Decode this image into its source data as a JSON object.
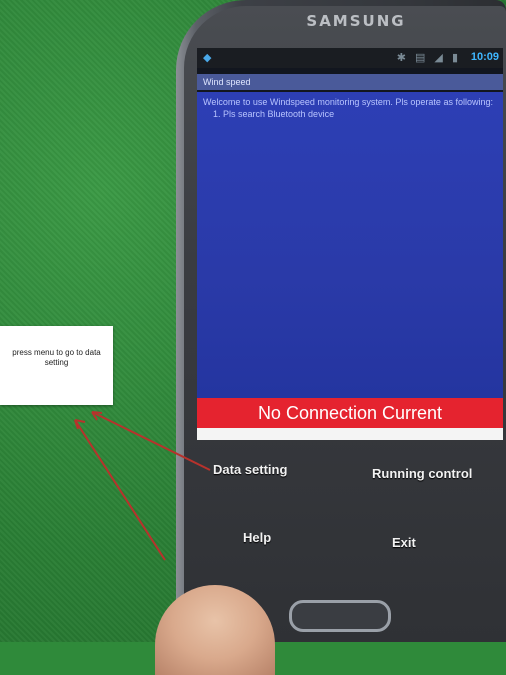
{
  "phone": {
    "brand": "SAMSUNG"
  },
  "statusbar": {
    "clock": "10:09",
    "icons": "✱ ▤ ◢ ▮"
  },
  "app": {
    "title": "Wind speed",
    "intro": "Welcome to use Windspeed monitoring system. Pls operate as following:",
    "steps": [
      "1.  Pls search Bluetooth device"
    ],
    "banner": "No Connection Current",
    "menu": {
      "data_setting": "Data setting",
      "running_control": "Running control",
      "help": "Help",
      "exit": "Exit"
    }
  },
  "annotation": {
    "note": "press menu to go to data setting",
    "arrow_color": "#b8322c"
  },
  "colors": {
    "banner": "#e5232f",
    "screen_blue": "#2a3aa8",
    "felt": "#2f8a3a"
  }
}
